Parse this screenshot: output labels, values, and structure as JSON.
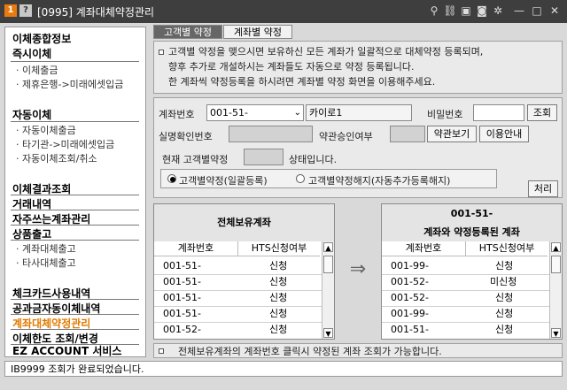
{
  "window": {
    "title": "[0995] 계좌대체약정관리",
    "badge1": "1",
    "badge2": "?"
  },
  "sidebar": {
    "sections": [
      {
        "head": "이체종합정보"
      },
      {
        "head": "즉시이체",
        "subs": [
          "· 이체출금",
          "· 제휴은행->미래에셋입금"
        ]
      },
      {
        "head": "자동이체",
        "subs": [
          "· 자동이체출금",
          "· 타기관->미래에셋입금",
          "· 자동이체조회/취소"
        ]
      },
      {
        "head": "이체결과조회"
      },
      {
        "head": "거래내역"
      },
      {
        "head": "자주쓰는계좌관리"
      },
      {
        "head": "상품출고",
        "subs": [
          "· 계좌대체출고",
          "· 타사대체출고"
        ]
      },
      {
        "head": "체크카드사용내역"
      },
      {
        "head": "공과금자동이체내역"
      },
      {
        "head": "계좌대체약정관리"
      },
      {
        "head": "이체한도 조회/변경"
      },
      {
        "head": "EZ ACCOUNT 서비스"
      }
    ]
  },
  "tabs": [
    "고객별 약정",
    "계좌별 약정"
  ],
  "info": [
    "고객별 약정을 맺으시면 보유하신 모든 계좌가 일괄적으로 대체약정 등록되며,",
    "향후 추가로 개설하시는 계좌들도 자동으로 약정 등록됩니다.",
    "한 계좌씩 약정등록을 하시려면 계좌별 약정 화면을 이용해주세요."
  ],
  "form": {
    "account_label": "계좌번호",
    "account_value": "001-51-",
    "account_name": "카이로1",
    "password_label": "비밀번호",
    "inquiry_btn": "조회",
    "verify_label": "실명확인번호",
    "approve_label": "약관승인여부",
    "terms_btn": "약관보기",
    "guide_btn": "이용안내",
    "current_label": "현재 고객별약정",
    "state_label": "상태입니다.",
    "radio1": "고객별약정(일괄등록)",
    "radio2": "고객별약정해지(자동추가등록해지)",
    "process_btn": "처리"
  },
  "left_table": {
    "title": "전체보유계좌",
    "col1": "계좌번호",
    "col2": "HTS신청여부",
    "rows": [
      [
        "001-51-",
        "신청"
      ],
      [
        "001-51-",
        "신청"
      ],
      [
        "001-51-",
        "신청"
      ],
      [
        "001-51-",
        "신청"
      ],
      [
        "001-52-",
        "신청"
      ]
    ]
  },
  "right_table": {
    "title1": "001-51-",
    "title2": "계좌와 약정등록된 계좌",
    "col1": "계좌번호",
    "col2": "HTS신청여부",
    "rows": [
      [
        "001-99-",
        "신청"
      ],
      [
        "001-52-",
        "미신청"
      ],
      [
        "001-52-",
        "신청"
      ],
      [
        "001-99-",
        "신청"
      ],
      [
        "001-51-",
        "신청"
      ]
    ]
  },
  "note": "전체보유계좌의 계좌번호 클릭시 약정된 계좌 조회가 가능합니다.",
  "status": "IB9999  조회가 완료되었습니다."
}
